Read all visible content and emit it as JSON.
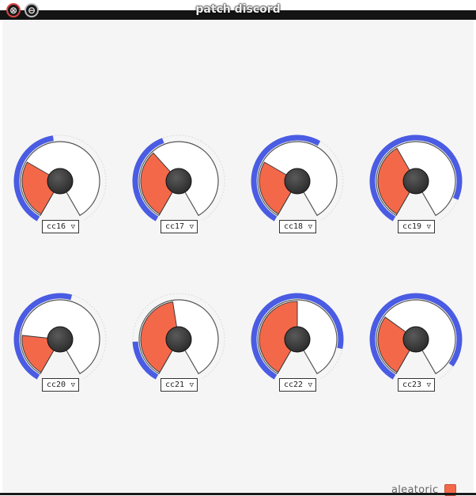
{
  "window": {
    "title": "patch discord",
    "close_glyph": "⊗",
    "minimize_glyph": "⊖"
  },
  "dials": [
    {
      "label": "cc16",
      "fill_level": 0.3,
      "range_level": 0.47
    },
    {
      "label": "cc17",
      "fill_level": 0.36,
      "range_level": 0.43
    },
    {
      "label": "cc18",
      "fill_level": 0.3,
      "range_level": 0.6
    },
    {
      "label": "cc19",
      "fill_level": 0.4,
      "range_level": 0.88
    },
    {
      "label": "cc20",
      "fill_level": 0.22,
      "range_level": 0.55
    },
    {
      "label": "cc21",
      "fill_level": 0.47,
      "range_level": 0.19
    },
    {
      "label": "cc22",
      "fill_level": 0.5,
      "range_level": 0.84
    },
    {
      "label": "cc23",
      "fill_level": 0.32,
      "range_level": 0.92
    }
  ],
  "legend": {
    "label": "aleatoric",
    "color": "#f4684a"
  },
  "colors": {
    "fill": "#f4684a",
    "range": "#4a5ce3",
    "knob": "#2a2a2a",
    "outline": "#555555"
  },
  "icons": {
    "close": "close-icon",
    "minimize": "minimize-icon",
    "dropdown": "triangle-down-icon"
  }
}
